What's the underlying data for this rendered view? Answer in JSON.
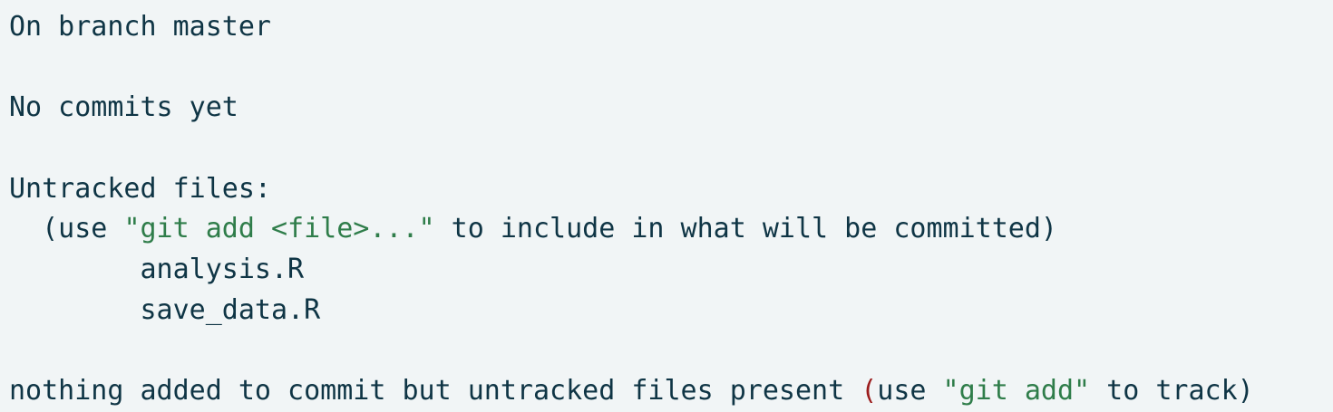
{
  "colors": {
    "background": "#f1f5f6",
    "text": "#0f3545",
    "string": "#2f7d4a",
    "paren": "#9b1c1c"
  },
  "status": {
    "branch_line": "On branch master",
    "no_commits": "No commits yet",
    "untracked_header": "Untracked files:",
    "hint": {
      "indent": "  ",
      "open": "(use ",
      "cmd": "\"git add <file>...\"",
      "rest": " to include in what will be committed)"
    },
    "files": [
      {
        "indent": "        ",
        "name": "analysis.R"
      },
      {
        "indent": "        ",
        "name": "save_data.R"
      }
    ],
    "summary": {
      "prefix": "nothing added to commit but untracked files present ",
      "paren_open": "(",
      "use": "use ",
      "cmd": "\"git add\"",
      "rest": " to track)"
    }
  }
}
